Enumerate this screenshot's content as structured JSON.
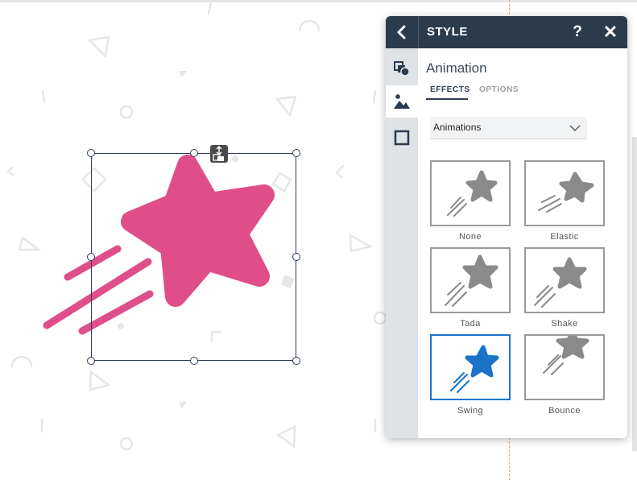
{
  "panel": {
    "title": "STYLE",
    "help_label": "?",
    "close_label": "✕",
    "section_title": "Animation",
    "tabs": [
      {
        "label": "EFFECTS",
        "active": true
      },
      {
        "label": "OPTIONS",
        "active": false
      }
    ],
    "dropdown": {
      "value": "Animations"
    },
    "animations": [
      {
        "label": "None",
        "selected": false
      },
      {
        "label": "Elastic",
        "selected": false
      },
      {
        "label": "Tada",
        "selected": false
      },
      {
        "label": "Shake",
        "selected": false
      },
      {
        "label": "Swing",
        "selected": true
      },
      {
        "label": "Bounce",
        "selected": false
      }
    ],
    "rail_icons": [
      "shapes-icon",
      "image-effects-icon",
      "border-icon"
    ]
  },
  "colors": {
    "header": "#2b3b4e",
    "selection_accent": "#1a73c8",
    "star": "#e04e8a",
    "preview_grey": "#8a8a8a"
  }
}
